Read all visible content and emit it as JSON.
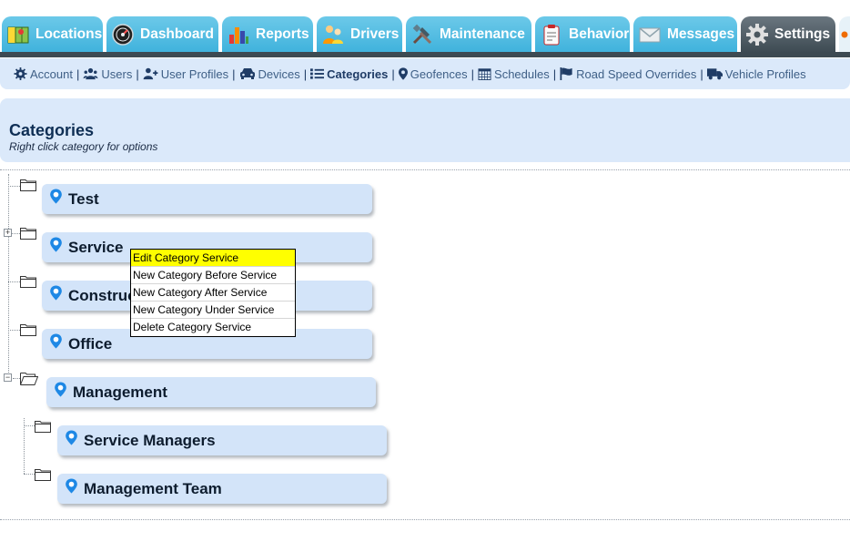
{
  "tabs": [
    {
      "label": "Locations",
      "icon": "map-icon",
      "active": false
    },
    {
      "label": "Dashboard",
      "icon": "speedometer-icon",
      "active": false
    },
    {
      "label": "Reports",
      "icon": "bar-chart-icon",
      "active": false
    },
    {
      "label": "Drivers",
      "icon": "drivers-icon",
      "active": false
    },
    {
      "label": "Maintenance",
      "icon": "tools-icon",
      "active": false
    },
    {
      "label": "Behavior",
      "icon": "clipboard-icon",
      "active": false
    },
    {
      "label": "Messages",
      "icon": "envelope-icon",
      "active": false
    },
    {
      "label": "Settings",
      "icon": "gear-icon",
      "active": true
    }
  ],
  "subnav": {
    "account": "Account",
    "users": "Users",
    "user_profiles": "User Profiles",
    "devices": "Devices",
    "categories": "Categories",
    "geofences": "Geofences",
    "schedules": "Schedules",
    "road_speed_overrides": "Road Speed Overrides",
    "vehicle_profiles": "Vehicle Profiles",
    "separator": "|"
  },
  "header": {
    "title": "Categories",
    "subtitle": "Right click category for options"
  },
  "tree": {
    "nodes": [
      {
        "label": "Test"
      },
      {
        "label": "Service"
      },
      {
        "label": "Construction"
      },
      {
        "label": "Office"
      },
      {
        "label": "Management"
      },
      {
        "label": "Service Managers"
      },
      {
        "label": "Management Team"
      }
    ],
    "expand_symbol": "+",
    "collapse_symbol": "−"
  },
  "context_menu": {
    "items": [
      {
        "label": "Edit Category Service",
        "highlighted": true
      },
      {
        "label": "New Category Before Service"
      },
      {
        "label": "New Category After Service"
      },
      {
        "label": "New Category Under Service"
      },
      {
        "label": "Delete Category Service"
      }
    ]
  },
  "colors": {
    "tab": "#4fbde2",
    "tab_active": "#4a565e",
    "panel": "#dbe9fa",
    "node": "#d3e4f9",
    "pin": "#1e88e5",
    "menu_highlight": "#ffff00"
  }
}
